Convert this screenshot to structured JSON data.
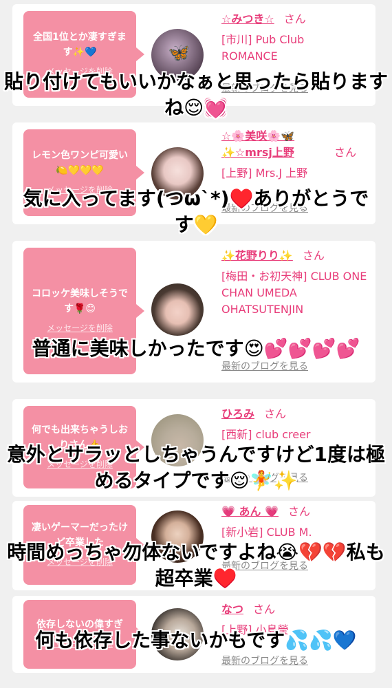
{
  "cards": [
    {
      "message": "全国1位とか凄すぎます✨💙",
      "delete_label": "メッセージを削除",
      "name": "☆みつき☆",
      "honorific": "さん",
      "shop": "[市川] Pub Club ROMANCE",
      "blog_label": "最新のブログを見る"
    },
    {
      "message": "レモン色ワンピ可愛い🍋💛💛💛",
      "delete_label": "メッセージを削除",
      "name": "☆🌸美咲🌸🦋✨☆mrsj上野",
      "honorific": "さん",
      "shop": "[上野] Mrs.J 上野",
      "blog_label": "最新のブログを見る"
    },
    {
      "message": "コロッケ美味しそうです🌹😊",
      "delete_label": "メッセージを削除",
      "name": "✨花野りり✨",
      "honorific": "さん",
      "shop": "[梅田・お初天神] CLUB ONE CHAN UMEDA OHATSUTENJIN",
      "blog_label": "最新のブログを見る"
    },
    {
      "message": "何でも出来ちゃうしおりさん👍",
      "delete_label": "メッセージを削除",
      "name": "ひろみ",
      "honorific": "さん",
      "shop": "[西新] club creer",
      "blog_label": "最新のブログを見る"
    },
    {
      "message": "凄いゲーマーだったけど卒業した",
      "delete_label": "メッセージを削除",
      "name": "💗 あん 💗",
      "honorific": "さん",
      "shop": "[新小岩] CLUB M.",
      "blog_label": "最新のブログを見る"
    },
    {
      "message": "依存しないの偉すぎ",
      "delete_label": "メッセージを削除",
      "name": "なつ",
      "honorific": "さん",
      "shop": "[上野] 小島瑩",
      "blog_label": "最新のブログを見る"
    }
  ],
  "captions": [
    "貼り付けてもいいかなぁと思ったら貼りますね😌💓",
    "気に入ってます(つω`*)♥️ありがとうです💛",
    "普通に美味しかったです😍💕💕💕💕",
    "意外とサラッとしちゃうんですけど1度は極めるタイプです😌🧚✨",
    "時間めっちゃ勿体ないですよね😭💔💔私も超卒業♥️",
    "何も依存した事ないかもです💦💦💙"
  ],
  "colors": {
    "bubble": "#f490a4",
    "accent": "#e83d7a",
    "page_bg": "#f0f0f0"
  }
}
